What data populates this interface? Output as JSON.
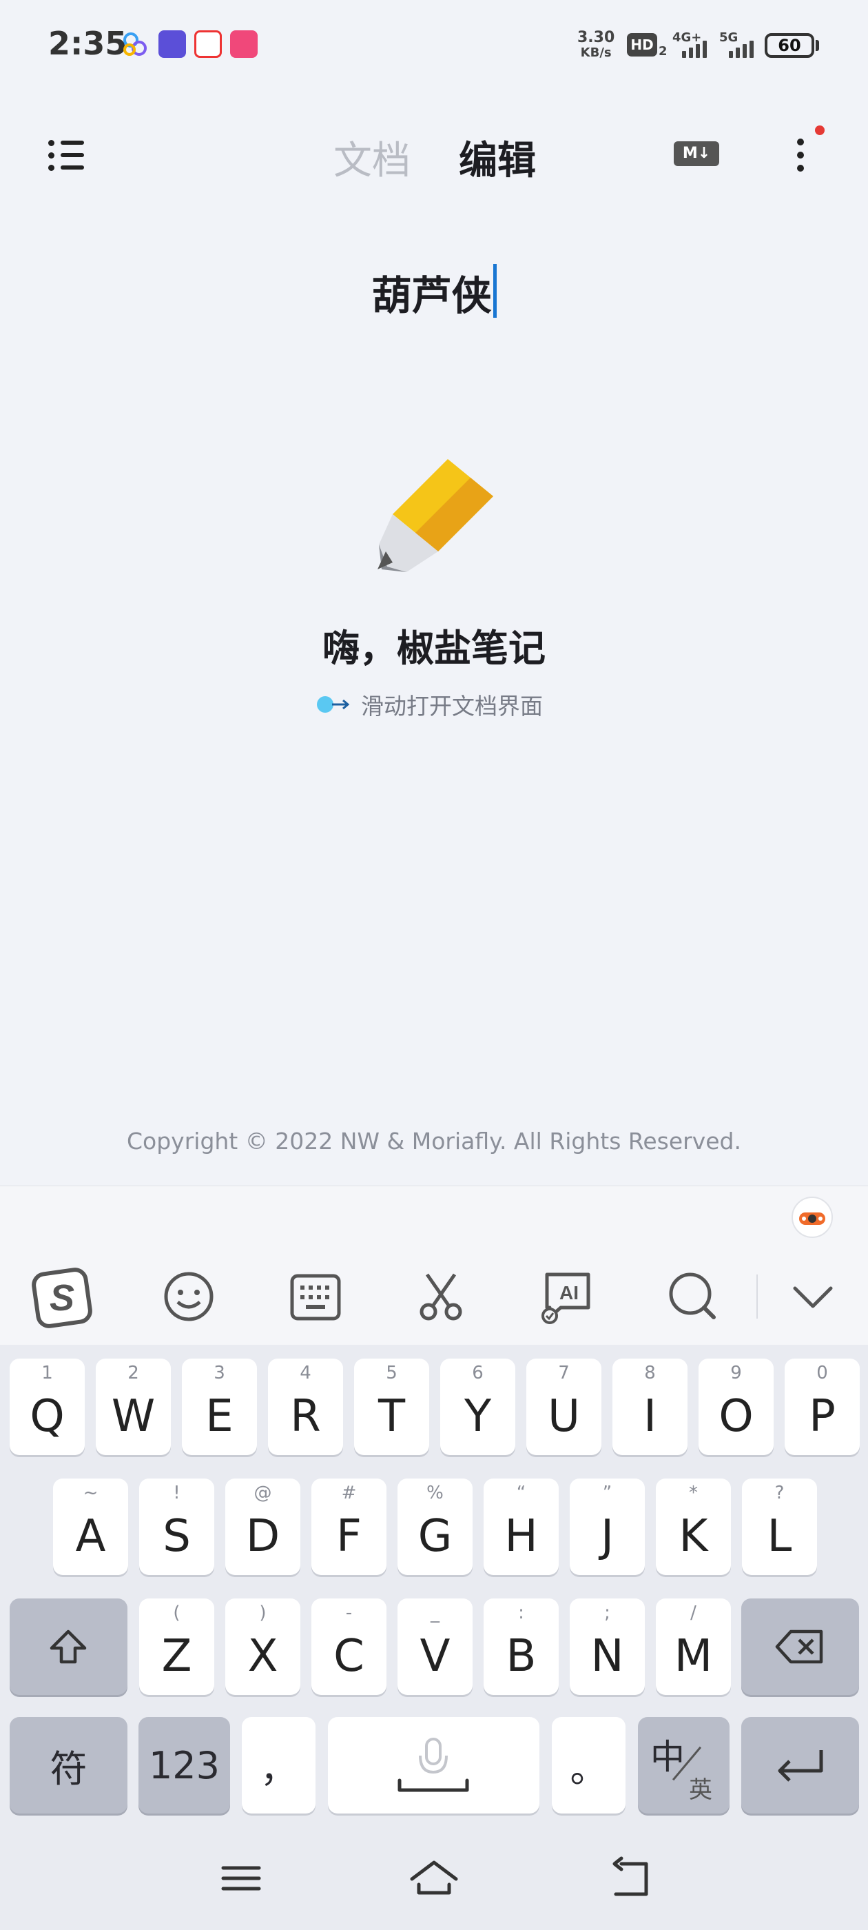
{
  "status_bar": {
    "time": "2:35",
    "net_speed_value": "3.30",
    "net_speed_unit": "KB/s",
    "hd_badge": "HD",
    "hd_sub": "2",
    "signal_1": "4G+",
    "signal_2": "5G",
    "battery": "60"
  },
  "header": {
    "tab_document": "文档",
    "tab_edit": "编辑",
    "markdown_badge": "M↓"
  },
  "editor": {
    "title": "葫芦侠",
    "welcome": "嗨，椒盐笔记",
    "hint": "滑动打开文档界面"
  },
  "footer": {
    "copyright": "Copyright © 2022 NW & Moriafly. All Rights Reserved."
  },
  "keyboard": {
    "row1": [
      {
        "main": "Q",
        "sub": "1"
      },
      {
        "main": "W",
        "sub": "2"
      },
      {
        "main": "E",
        "sub": "3"
      },
      {
        "main": "R",
        "sub": "4"
      },
      {
        "main": "T",
        "sub": "5"
      },
      {
        "main": "Y",
        "sub": "6"
      },
      {
        "main": "U",
        "sub": "7"
      },
      {
        "main": "I",
        "sub": "8"
      },
      {
        "main": "O",
        "sub": "9"
      },
      {
        "main": "P",
        "sub": "0"
      }
    ],
    "row2": [
      {
        "main": "A",
        "sub": "~"
      },
      {
        "main": "S",
        "sub": "!"
      },
      {
        "main": "D",
        "sub": "@"
      },
      {
        "main": "F",
        "sub": "#"
      },
      {
        "main": "G",
        "sub": "%"
      },
      {
        "main": "H",
        "sub": "“"
      },
      {
        "main": "J",
        "sub": "”"
      },
      {
        "main": "K",
        "sub": "*"
      },
      {
        "main": "L",
        "sub": "?"
      }
    ],
    "row3": [
      {
        "main": "Z",
        "sub": "("
      },
      {
        "main": "X",
        "sub": ")"
      },
      {
        "main": "C",
        "sub": "-"
      },
      {
        "main": "V",
        "sub": "_"
      },
      {
        "main": "B",
        "sub": ":"
      },
      {
        "main": "N",
        "sub": ";"
      },
      {
        "main": "M",
        "sub": "/"
      }
    ],
    "symbols_key": "符",
    "numbers_key": "123",
    "comma_key": "，",
    "period_key": "。",
    "lang_key_main": "中",
    "lang_key_sub": "英"
  },
  "icons": {
    "toolbar": [
      "sogou-logo-icon",
      "emoji-icon",
      "keyboard-icon",
      "scissors-icon",
      "ai-icon",
      "search-icon",
      "collapse-icon"
    ],
    "nav": [
      "menu-icon",
      "home-icon",
      "back-icon"
    ]
  },
  "colors": {
    "accent": "#1976d2",
    "notification": "#e53935",
    "pencil": "#f5c518"
  }
}
